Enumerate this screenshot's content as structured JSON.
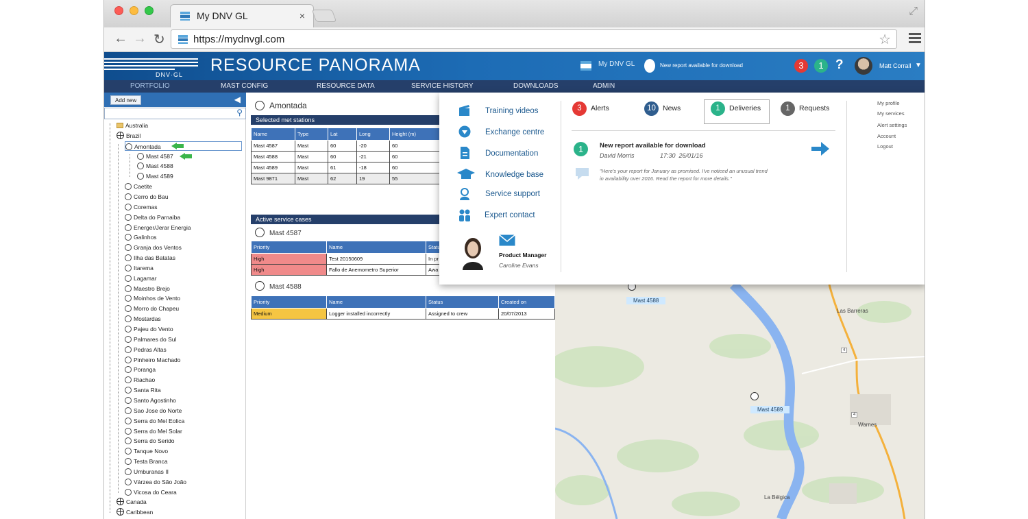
{
  "browser": {
    "tab_title": "My DNV GL",
    "tab_close": "×",
    "url": "https://mydnvgl.com"
  },
  "header": {
    "logo_text": "DNV·GL",
    "brand": "RESOURCE PANORAMA",
    "my_dnv": "My DNV GL",
    "notification": "New report available for download",
    "badge_alerts": "3",
    "badge_deliveries": "1",
    "help": "?",
    "user_name": "Matt Corrall"
  },
  "nav": [
    "PORTFOLIO",
    "MAST CONFIG",
    "RESOURCE DATA",
    "SERVICE HISTORY",
    "DOWNLOADS",
    "ADMIN"
  ],
  "sidebar": {
    "add_new": "Add new",
    "tree": [
      {
        "label": "Australia",
        "level": 1,
        "icon": "folder"
      },
      {
        "label": "Brazil",
        "level": 1,
        "icon": "globe"
      },
      {
        "label": "Amontada",
        "level": 2,
        "icon": "site",
        "selected": true
      },
      {
        "label": "Mast 4587",
        "level": 3,
        "icon": "mast"
      },
      {
        "label": "Mast 4588",
        "level": 3,
        "icon": "mast"
      },
      {
        "label": "Mast 4589",
        "level": 3,
        "icon": "mast"
      },
      {
        "label": "Caetite",
        "level": 2,
        "icon": "site"
      },
      {
        "label": "Cerro do Bau",
        "level": 2,
        "icon": "site"
      },
      {
        "label": "Coremas",
        "level": 2,
        "icon": "site"
      },
      {
        "label": "Delta do Parnaiba",
        "level": 2,
        "icon": "site"
      },
      {
        "label": "Energer/Jerar Energia",
        "level": 2,
        "icon": "site"
      },
      {
        "label": "Galinhos",
        "level": 2,
        "icon": "site"
      },
      {
        "label": "Granja dos Ventos",
        "level": 2,
        "icon": "site"
      },
      {
        "label": "Ilha das Batatas",
        "level": 2,
        "icon": "site"
      },
      {
        "label": "Itarema",
        "level": 2,
        "icon": "site"
      },
      {
        "label": "Lagamar",
        "level": 2,
        "icon": "site"
      },
      {
        "label": "Maestro Brejo",
        "level": 2,
        "icon": "site"
      },
      {
        "label": "Moinhos de Vento",
        "level": 2,
        "icon": "site"
      },
      {
        "label": "Morro do Chapeu",
        "level": 2,
        "icon": "site"
      },
      {
        "label": "Mostardas",
        "level": 2,
        "icon": "site"
      },
      {
        "label": "Pajeu do Vento",
        "level": 2,
        "icon": "site"
      },
      {
        "label": "Palmares do Sul",
        "level": 2,
        "icon": "site"
      },
      {
        "label": "Pedras Altas",
        "level": 2,
        "icon": "site"
      },
      {
        "label": "Pinheiro Machado",
        "level": 2,
        "icon": "site"
      },
      {
        "label": "Poranga",
        "level": 2,
        "icon": "site"
      },
      {
        "label": "Riachao",
        "level": 2,
        "icon": "site"
      },
      {
        "label": "Santa Rita",
        "level": 2,
        "icon": "site"
      },
      {
        "label": "Santo Agostinho",
        "level": 2,
        "icon": "site"
      },
      {
        "label": "Sao Jose do Norte",
        "level": 2,
        "icon": "site"
      },
      {
        "label": "Serra do Mel Eolica",
        "level": 2,
        "icon": "site"
      },
      {
        "label": "Serra do Mel Solar",
        "level": 2,
        "icon": "site"
      },
      {
        "label": "Serra do Serido",
        "level": 2,
        "icon": "site"
      },
      {
        "label": "Tanque Novo",
        "level": 2,
        "icon": "site"
      },
      {
        "label": "Testa Branca",
        "level": 2,
        "icon": "site"
      },
      {
        "label": "Umburanas II",
        "level": 2,
        "icon": "site"
      },
      {
        "label": "Várzea do São João",
        "level": 2,
        "icon": "site"
      },
      {
        "label": "Vicosa do Ceara",
        "level": 2,
        "icon": "site"
      },
      {
        "label": "Canada",
        "level": 1,
        "icon": "globe"
      },
      {
        "label": "Caribbean",
        "level": 1,
        "icon": "globe"
      }
    ]
  },
  "content": {
    "site_title": "Amontada",
    "stations_header": "Selected met stations",
    "stations_columns": [
      "Name",
      "Type",
      "Lat",
      "Long",
      "Height (m)"
    ],
    "stations_rows": [
      [
        "Mast 4587",
        "Mast",
        "60",
        "-20",
        "60"
      ],
      [
        "Mast 4588",
        "Mast",
        "60",
        "-21",
        "60"
      ],
      [
        "Mast 4589",
        "Mast",
        "61",
        "-18",
        "60"
      ],
      [
        "Mast 9871",
        "Mast",
        "62",
        "19",
        "55"
      ]
    ],
    "service_header": "Active service cases",
    "case1_title": "Mast 4587",
    "case1_columns": [
      "Priority",
      "Name",
      "Statu"
    ],
    "case1_rows": [
      [
        "High",
        "Test 20150609",
        "In pr"
      ],
      [
        "High",
        "Fallo de Anemometro Superior",
        "Awa"
      ]
    ],
    "case2_title": "Mast 4588",
    "case2_columns": [
      "Priority",
      "Name",
      "Status",
      "Created on"
    ],
    "case2_rows": [
      [
        "Medium",
        "Logger installed incorrectly",
        "Assigned to crew",
        "20/07/2013"
      ]
    ]
  },
  "overlay": {
    "links": [
      "Training videos",
      "Exchange centre",
      "Documentation",
      "Knowledge base",
      "Service support",
      "Expert contact"
    ],
    "contact_role": "Product Manager",
    "contact_name": "Caroline Evans",
    "tabs": [
      {
        "count": "3",
        "label": "Alerts",
        "color": "#e53935"
      },
      {
        "count": "10",
        "label": "News",
        "color": "#2f5d8e"
      },
      {
        "count": "1",
        "label": "Deliveries",
        "color": "#2bb38a"
      },
      {
        "count": "1",
        "label": "Requests",
        "color": "#666666"
      }
    ],
    "item_count": "1",
    "item_title": "New report available for download",
    "item_author": "David Morris",
    "item_time": "17:30  26/01/16",
    "item_quote_line1": "\"Here's your report for January as promised. I've noticed an unusual trend",
    "item_quote_line2": "in availability over 2016. Read the report for more details.\"",
    "right_links": [
      "My profile",
      "My services",
      "Alert settings",
      "Account",
      "Logout"
    ]
  },
  "map": {
    "labels": [
      "Mast 4588",
      "Mast 4589"
    ],
    "towns": [
      "Las Barreras",
      "Warnes",
      "La Bélgica"
    ],
    "road_markers": [
      "4",
      "4"
    ]
  }
}
